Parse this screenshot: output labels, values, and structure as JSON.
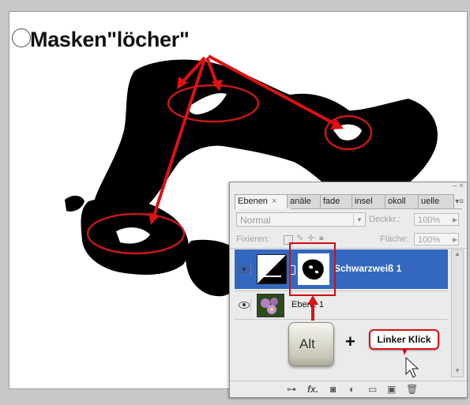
{
  "annotation": {
    "title": "Masken\"löcher\"",
    "colors": {
      "arrow": "#dd1111",
      "ellipse": "#c41818"
    }
  },
  "panel": {
    "window_controls": "– ×",
    "panel_menu_icon": "panel-menu-icon",
    "tabs": [
      {
        "label": "Ebenen",
        "close": "×"
      },
      {
        "label": "anäle"
      },
      {
        "label": "fade"
      },
      {
        "label": "insel"
      },
      {
        "label": "okoll"
      },
      {
        "label": "uelle"
      }
    ],
    "blend_mode": "Normal",
    "opacity_label": "Deckkr.:",
    "opacity_value": "100%",
    "lock_label": "Fixieren:",
    "fill_label": "Fläche:",
    "fill_value": "100%",
    "layers": [
      {
        "name": "Schwarzweiß 1",
        "selected": true,
        "type": "adjustment"
      },
      {
        "name": "Ebene 1",
        "selected": false,
        "type": "pixel"
      }
    ],
    "colors": {
      "selection": "#3468c0",
      "panel_bg": "#ebebeb"
    }
  },
  "callouts": {
    "key": "Alt",
    "plus": "+",
    "click_label": "Linker Klick"
  }
}
